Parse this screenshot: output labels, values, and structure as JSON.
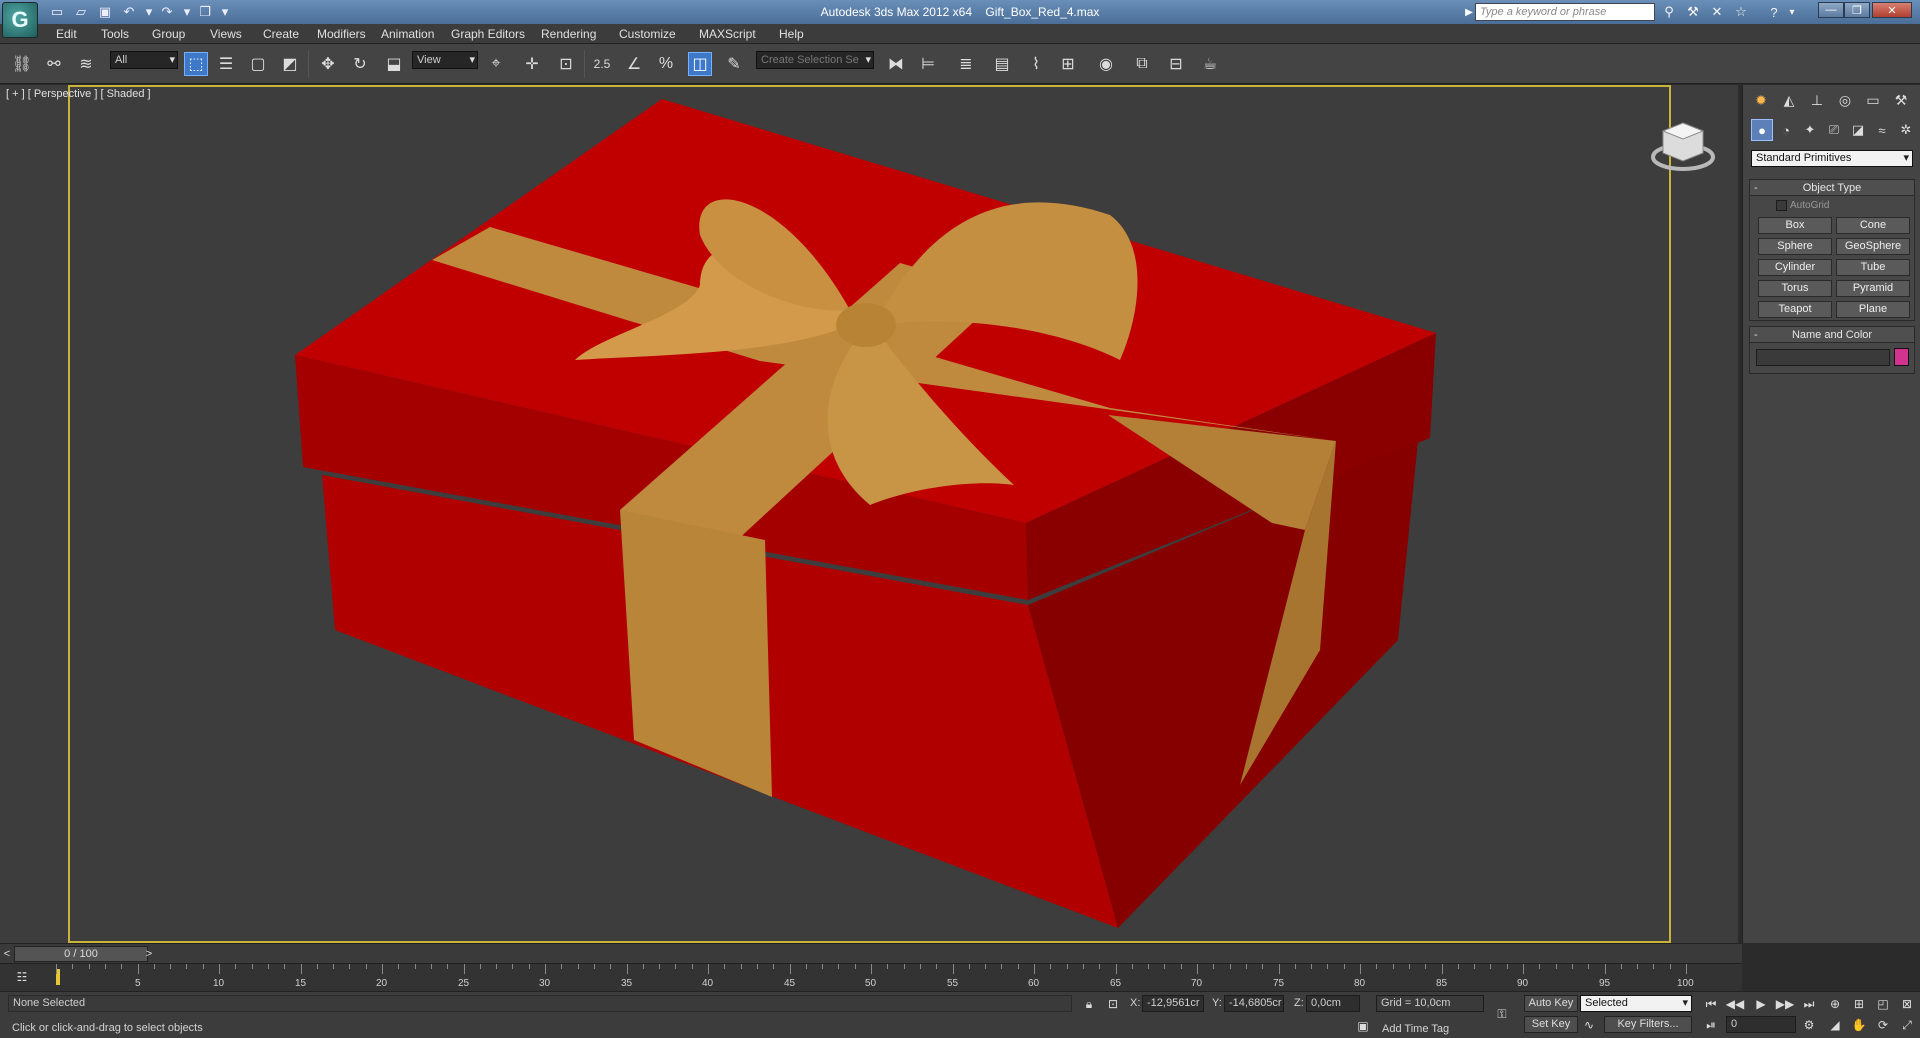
{
  "title_bar": {
    "app_title": "Autodesk 3ds Max  2012 x64",
    "file_name": "Gift_Box_Red_4.max",
    "search_placeholder": "Type a keyword or phrase",
    "logo_text": "G"
  },
  "menu": {
    "items": [
      "Edit",
      "Tools",
      "Group",
      "Views",
      "Create",
      "Modifiers",
      "Animation",
      "Graph Editors",
      "Rendering",
      "Customize",
      "MAXScript",
      "Help"
    ]
  },
  "toolbar": {
    "selection_filter": "All",
    "reference_coord": "View",
    "named_selection_placeholder": "Create Selection Se",
    "snap_label": "2.5"
  },
  "viewport": {
    "label": "[ + ] [ Perspective ] [ Shaded ]",
    "border_color": "#c9b439",
    "box_color": "#b30000",
    "ribbon_color": "#c08a3e"
  },
  "command_panel": {
    "dropdown": "Standard Primitives",
    "object_type": {
      "title": "Object Type",
      "autogrid": "AutoGrid",
      "buttons": [
        "Box",
        "Cone",
        "Sphere",
        "GeoSphere",
        "Cylinder",
        "Tube",
        "Torus",
        "Pyramid",
        "Teapot",
        "Plane"
      ]
    },
    "name_and_color": {
      "title": "Name and Color",
      "name_value": "",
      "color": "#d2338f"
    }
  },
  "time_slider": {
    "position": "0 / 100",
    "current_frame": 0,
    "total_frames": 100
  },
  "track_bar": {
    "tick_labels": [
      "5",
      "10",
      "15",
      "20",
      "25",
      "30",
      "35",
      "40",
      "45",
      "50",
      "55",
      "60",
      "65",
      "70",
      "75",
      "80",
      "85",
      "90",
      "95",
      "100"
    ]
  },
  "status": {
    "selection": "None Selected",
    "prompt": "Click or click-and-drag to select objects",
    "x_label": "X:",
    "x_value": "-12,9561cr",
    "y_label": "Y:",
    "y_value": "-14,6805cr",
    "z_label": "Z:",
    "z_value": "0,0cm",
    "grid": "Grid = 10,0cm",
    "add_time_tag": "Add Time Tag",
    "auto_key": "Auto Key",
    "set_key": "Set Key",
    "key_mode": "Selected",
    "key_filters": "Key Filters...",
    "frame_field": "0"
  }
}
